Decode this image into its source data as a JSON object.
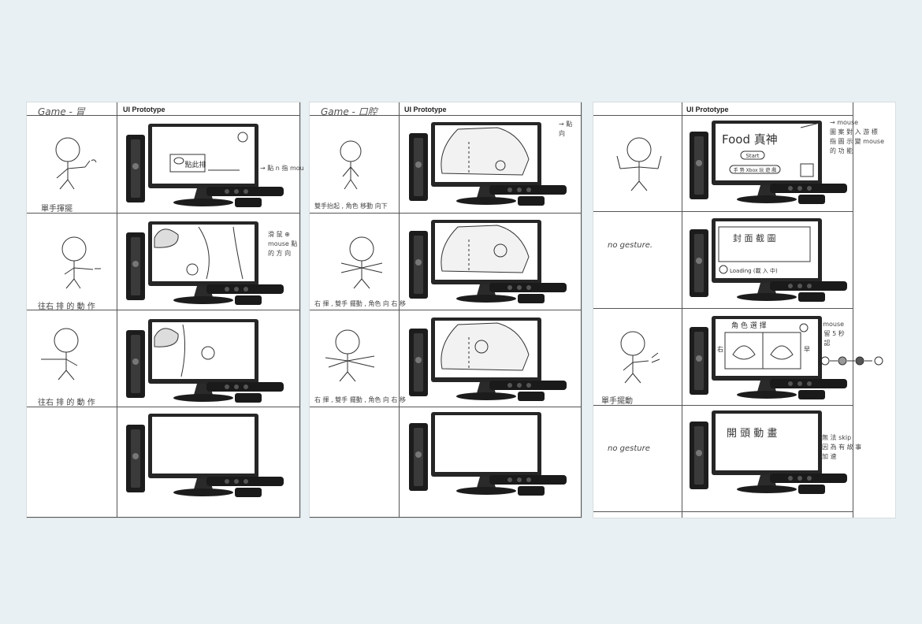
{
  "sheets": [
    {
      "game_label": "Game - 冒",
      "ui_label": "UI Prototype",
      "rows": [
        {
          "gesture": "單手揮擺",
          "screen_text": "點此排",
          "note": "→ 點 n 指 mou"
        },
        {
          "gesture": "往右 排 的 動 作",
          "note": "滑 鼠 ⊕\nmouse 點\n的 方 向"
        },
        {
          "gesture": "往右 排 的 動 作",
          "note": ""
        },
        {
          "gesture": "",
          "note": ""
        }
      ]
    },
    {
      "game_label": "Game - 口腔",
      "ui_label": "UI Prototype",
      "corner_note": "→ 點\n向",
      "rows": [
        {
          "gesture": "雙手抬起 , 角色 移動 向下"
        },
        {
          "gesture": "右 揮 , 雙手 擺動 , 角色 向 右 移"
        },
        {
          "gesture": "右 揮 , 雙手 擺動 , 角色 向 右 移"
        },
        {
          "gesture": ""
        }
      ]
    },
    {
      "ui_label": "UI Prototype",
      "rows": [
        {
          "gesture": "",
          "screen_title": "Food 真神",
          "screen_btn1": "Start",
          "screen_btn2": "手 勢 Xbox 玩 遊 戲",
          "note": "→ mouse\n圖 案 對 入 游 標\n指 圖 示 變 mouse\n的 功 能"
        },
        {
          "gesture": "no gesture.",
          "screen_title": "封 面 截 圖",
          "screen_btn": "Loading (載 入 中)"
        },
        {
          "gesture": "單手擺動",
          "screen_title": "角 色 選 擇",
          "screen_left": "右",
          "screen_right": "早",
          "note": "→ mouse\n停 留 5 秒\n確 認"
        },
        {
          "gesture": "no gesture",
          "screen_title": "開 頭 動 畫",
          "note": "無 法 skip\n因 為 有 故 事\n加 速"
        }
      ]
    }
  ]
}
